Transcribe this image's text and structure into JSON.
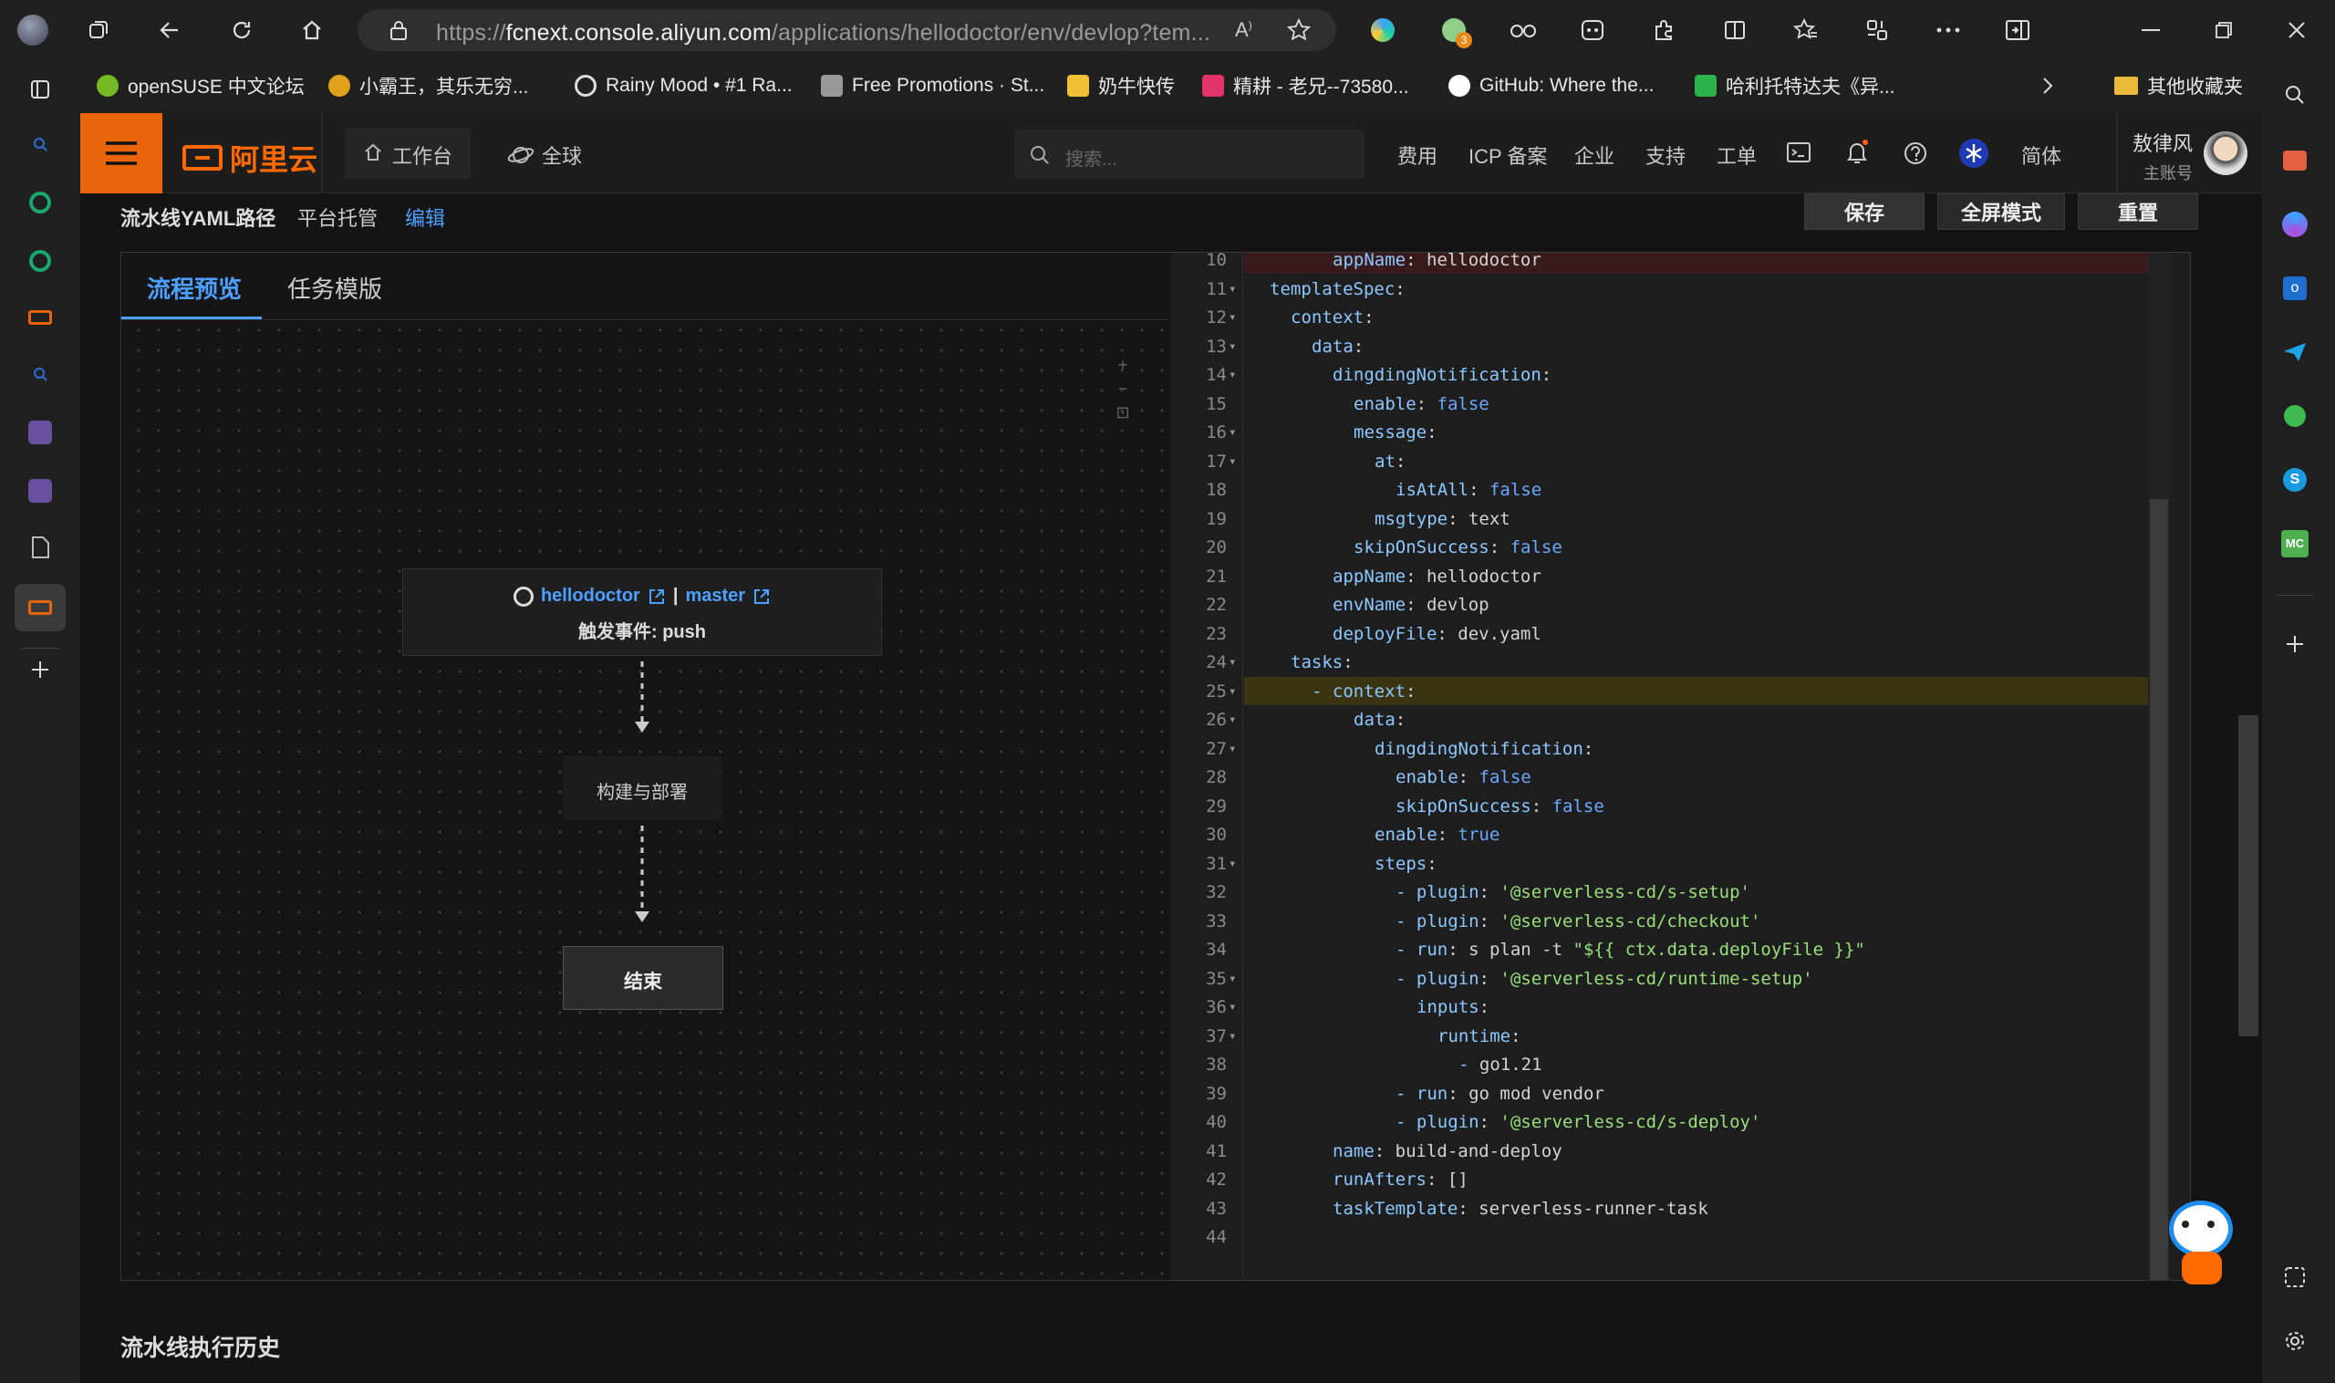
{
  "browser": {
    "url_prefix": "https://",
    "url_host": "fcnext.console.aliyun.com",
    "url_path": "/applications/hellodoctor/env/devlop?tem...",
    "extension_badge": "3",
    "bookmarks": [
      {
        "label": "openSUSE 中文论坛",
        "color": "#73ba25"
      },
      {
        "label": "小霸王，其乐无穷...",
        "color": "#e0a21b"
      },
      {
        "label": "Rainy Mood • #1 Ra...",
        "color": "#dddddd"
      },
      {
        "label": "Free Promotions · St...",
        "color": "#aaaaaa"
      },
      {
        "label": "奶牛快传",
        "color": "#f2c037"
      },
      {
        "label": "精耕 - 老兄--73580...",
        "color": "#e2336b"
      },
      {
        "label": "GitHub: Where the...",
        "color": "#ffffff"
      },
      {
        "label": "哈利托特达夫《异...",
        "color": "#2db34a"
      }
    ],
    "other_bookmarks": "其他收藏夹"
  },
  "console": {
    "brand": "阿里云",
    "nav": {
      "workbench": "工作台",
      "region": "全球"
    },
    "search_placeholder": "搜索...",
    "menu": [
      "费用",
      "ICP 备案",
      "企业",
      "支持",
      "工单"
    ],
    "lang": "简体",
    "user": {
      "name": "敖律风",
      "role": "主账号"
    }
  },
  "subbar": {
    "yaml_path_label": "流水线YAML路径",
    "hosting": "平台托管",
    "edit_link": "编辑",
    "save": "保存",
    "fullscreen": "全屏模式",
    "reset": "重置"
  },
  "preview": {
    "tabs": [
      "流程预览",
      "任务模版"
    ],
    "active_tab": 0,
    "trigger": {
      "repo": "hellodoctor",
      "branch": "master",
      "event_label": "触发事件: push"
    },
    "task_node": "构建与部署",
    "end_node": "结束",
    "zoom_controls": [
      "+",
      "−",
      "⊡"
    ]
  },
  "editor": {
    "lines": [
      {
        "n": 10,
        "indent": 4,
        "key": "appName",
        "val": "hellodoctor",
        "vtype": "plain"
      },
      {
        "n": 11,
        "indent": 1,
        "key": "templateSpec",
        "val": "",
        "fold": true
      },
      {
        "n": 12,
        "indent": 2,
        "key": "context",
        "val": "",
        "fold": true
      },
      {
        "n": 13,
        "indent": 3,
        "key": "data",
        "val": "",
        "fold": true
      },
      {
        "n": 14,
        "indent": 4,
        "key": "dingdingNotification",
        "val": "",
        "fold": true
      },
      {
        "n": 15,
        "indent": 5,
        "key": "enable",
        "val": "false",
        "vtype": "bool"
      },
      {
        "n": 16,
        "indent": 5,
        "key": "message",
        "val": "",
        "fold": true
      },
      {
        "n": 17,
        "indent": 6,
        "key": "at",
        "val": "",
        "fold": true
      },
      {
        "n": 18,
        "indent": 7,
        "key": "isAtAll",
        "val": "false",
        "vtype": "bool"
      },
      {
        "n": 19,
        "indent": 6,
        "key": "msgtype",
        "val": "text",
        "vtype": "plain"
      },
      {
        "n": 20,
        "indent": 5,
        "key": "skipOnSuccess",
        "val": "false",
        "vtype": "bool"
      },
      {
        "n": 21,
        "indent": 4,
        "key": "appName",
        "val": "hellodoctor",
        "vtype": "plain"
      },
      {
        "n": 22,
        "indent": 4,
        "key": "envName",
        "val": "devlop",
        "vtype": "plain"
      },
      {
        "n": 23,
        "indent": 4,
        "key": "deployFile",
        "val": "dev.yaml",
        "vtype": "plain"
      },
      {
        "n": 24,
        "indent": 2,
        "key": "tasks",
        "val": "",
        "fold": true
      },
      {
        "n": 25,
        "indent": 3,
        "dash": true,
        "key": "context",
        "val": "",
        "fold": true,
        "highlight": true
      },
      {
        "n": 26,
        "indent": 5,
        "key": "data",
        "val": "",
        "fold": true
      },
      {
        "n": 27,
        "indent": 6,
        "key": "dingdingNotification",
        "val": "",
        "fold": true
      },
      {
        "n": 28,
        "indent": 7,
        "key": "enable",
        "val": "false",
        "vtype": "bool"
      },
      {
        "n": 29,
        "indent": 7,
        "key": "skipOnSuccess",
        "val": "false",
        "vtype": "bool"
      },
      {
        "n": 30,
        "indent": 6,
        "key": "enable",
        "val": "true",
        "vtype": "bool"
      },
      {
        "n": 31,
        "indent": 6,
        "key": "steps",
        "val": "",
        "fold": true
      },
      {
        "n": 32,
        "indent": 7,
        "dash": true,
        "key": "plugin",
        "val": "'@serverless-cd/s-setup'",
        "vtype": "str"
      },
      {
        "n": 33,
        "indent": 7,
        "dash": true,
        "key": "plugin",
        "val": "'@serverless-cd/checkout'",
        "vtype": "str"
      },
      {
        "n": 34,
        "indent": 7,
        "dash": true,
        "key": "run",
        "val": "s plan -t ",
        "val2": "\"${{ ctx.data.deployFile }}\"",
        "vtype": "plain"
      },
      {
        "n": 35,
        "indent": 7,
        "dash": true,
        "key": "plugin",
        "val": "'@serverless-cd/runtime-setup'",
        "vtype": "str",
        "fold": true
      },
      {
        "n": 36,
        "indent": 8,
        "key": "inputs",
        "val": "",
        "fold": true
      },
      {
        "n": 37,
        "indent": 9,
        "key": "runtime",
        "val": "",
        "fold": true
      },
      {
        "n": 38,
        "indent": 10,
        "dash": true,
        "key": "",
        "val": "go1.21",
        "vtype": "plain"
      },
      {
        "n": 39,
        "indent": 7,
        "dash": true,
        "key": "run",
        "val": "go mod vendor",
        "vtype": "plain"
      },
      {
        "n": 40,
        "indent": 7,
        "dash": true,
        "key": "plugin",
        "val": "'@serverless-cd/s-deploy'",
        "vtype": "str"
      },
      {
        "n": 41,
        "indent": 4,
        "key": "name",
        "val": "build-and-deploy",
        "vtype": "plain"
      },
      {
        "n": 42,
        "indent": 4,
        "key": "runAfters",
        "val": "[]",
        "vtype": "plain"
      },
      {
        "n": 43,
        "indent": 4,
        "key": "taskTemplate",
        "val": "serverless-runner-task",
        "vtype": "plain"
      },
      {
        "n": 44,
        "indent": 0,
        "key": "",
        "val": ""
      }
    ]
  },
  "history_title": "流水线执行历史"
}
